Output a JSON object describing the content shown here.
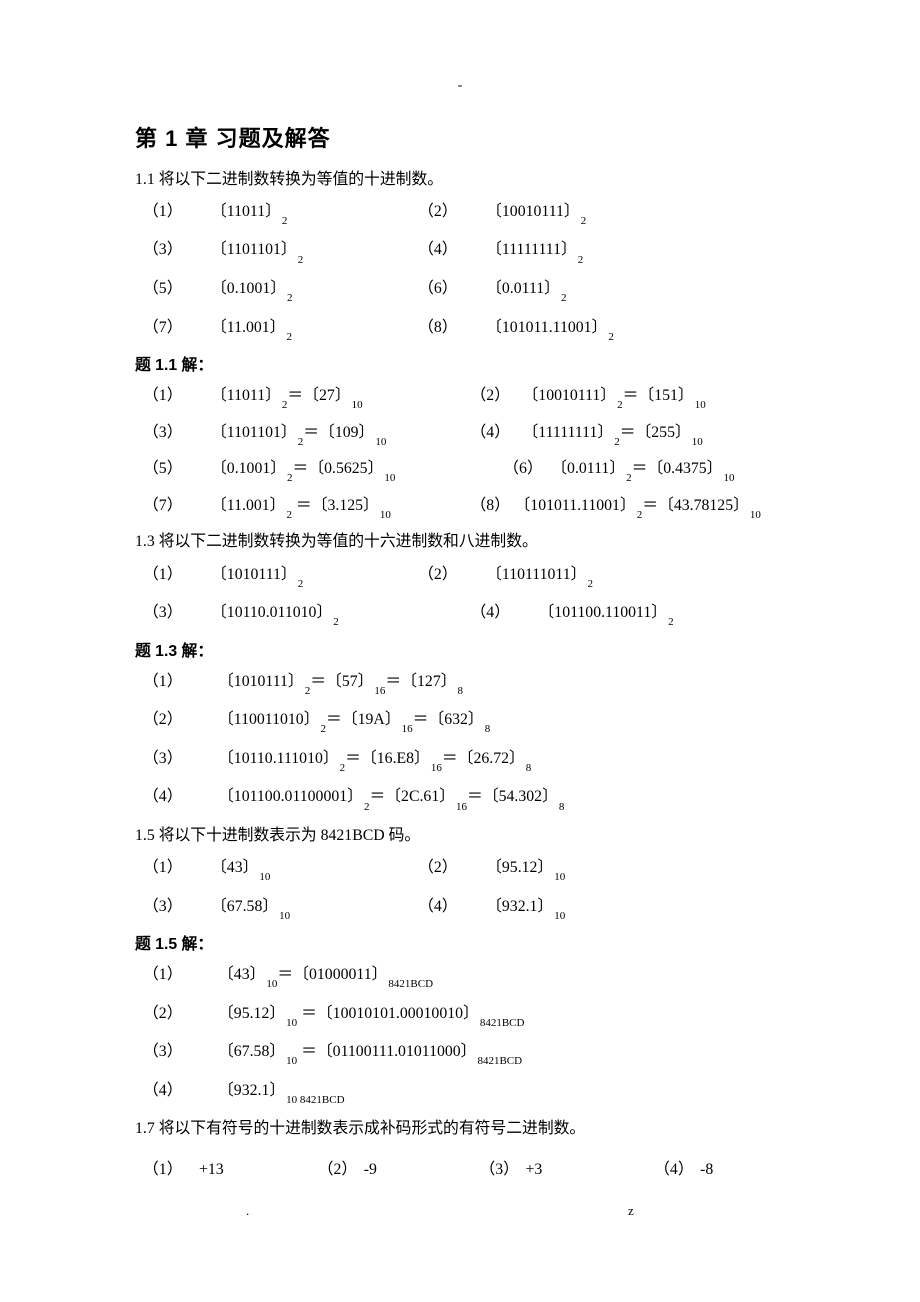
{
  "top_dash": "-",
  "chapter_title": "第 1 章 习题及解答",
  "s11": {
    "title": "1.1 将以下二进制数转换为等值的十进制数。",
    "items": [
      {
        "n": "（1）",
        "v": "〔11011〕",
        "b": "2"
      },
      {
        "n": "（2）",
        "v": "〔10010111〕",
        "b": "2"
      },
      {
        "n": "（3）",
        "v": "〔1101101〕",
        "b": "2"
      },
      {
        "n": "（4）",
        "v": "〔11111111〕",
        "b": "2"
      },
      {
        "n": "（5）",
        "v": "〔0.1001〕",
        "b": "2"
      },
      {
        "n": "（6）",
        "v": "〔0.0111〕",
        "b": "2"
      },
      {
        "n": "（7）",
        "v": "〔11.001〕",
        "b": "2"
      },
      {
        "n": "（8）",
        "v": "〔101011.11001〕",
        "b": "2"
      }
    ],
    "sol_title": "题 1.1  解：",
    "sol": [
      {
        "n": "（1）",
        "l": "〔11011〕",
        "lb": "2",
        "m": "＝〔27〕",
        "rb": "10"
      },
      {
        "n": "（2）",
        "l": "〔10010111〕",
        "lb": "2",
        "m": "＝〔151〕",
        "rb": "10"
      },
      {
        "n": "（3）",
        "l": "〔1101101〕",
        "lb": "2",
        "m": "＝〔109〕",
        "rb": "10"
      },
      {
        "n": "（4）",
        "l": "〔11111111〕",
        "lb": "2",
        "m": "＝〔255〕",
        "rb": "10"
      },
      {
        "n": "（5）",
        "l": "〔0.1001〕",
        "lb": "2",
        "m": "＝〔0.5625〕",
        "rb": "10"
      },
      {
        "n": "（6）",
        "l": "〔0.0111〕",
        "lb": "2",
        "m": "＝〔0.4375〕",
        "rb": "10"
      },
      {
        "n": "（7）",
        "l": "〔11.001〕",
        "lb": "2",
        "m": " ＝〔3.125〕",
        "rb": "10"
      },
      {
        "n": "（8）",
        "l": "〔101011.11001〕",
        "lb": "2",
        "m": "＝〔43.78125〕",
        "rb": "10"
      }
    ]
  },
  "s13": {
    "title": "1.3 将以下二进制数转换为等值的十六进制数和八进制数。",
    "items": [
      {
        "n": "（1）",
        "v": "〔1010111〕",
        "b": "2"
      },
      {
        "n": "（2）",
        "v": "〔110111011〕",
        "b": "2"
      },
      {
        "n": "（3）",
        "v": "〔10110.011010〕",
        "b": "2"
      },
      {
        "n": "（4）",
        "v": "〔101100.110011〕",
        "b": "2"
      }
    ],
    "sol_title": "题 1.3  解：",
    "sol": [
      {
        "n": "（1）",
        "a": "〔1010111〕",
        "ab": "2",
        "b": "＝〔57〕",
        "bb": "16",
        "c": "＝〔127〕",
        "cb": "8"
      },
      {
        "n": "（2）",
        "a": "〔110011010〕",
        "ab": "2",
        "b": "＝〔19A〕",
        "bb": "16",
        "c": "＝〔632〕",
        "cb": "8"
      },
      {
        "n": "（3）",
        "a": "〔10110.111010〕",
        "ab": "2",
        "b": "＝〔16.E8〕",
        "bb": "16",
        "c": "＝〔26.72〕",
        "cb": "8"
      },
      {
        "n": "（4）",
        "a": "〔101100.01100001〕",
        "ab": "2",
        "b": "＝〔2C.61〕",
        "bb": "16",
        "c": "＝〔54.302〕",
        "cb": "8"
      }
    ]
  },
  "s15": {
    "title": "1.5 将以下十进制数表示为 8421BCD 码。",
    "items": [
      {
        "n": "（1）",
        "v": "〔43〕",
        "b": "10"
      },
      {
        "n": "（2）",
        "v": "〔95.12〕",
        "b": "10"
      },
      {
        "n": "（3）",
        "v": "〔67.58〕",
        "b": "10"
      },
      {
        "n": "（4）",
        "v": "〔932.1〕",
        "b": "10"
      }
    ],
    "sol_title": "题 1.5  解：",
    "sol": [
      {
        "n": "（1）",
        "a": "〔43〕",
        "ab": "10",
        "b": "＝〔01000011〕",
        "bb": "8421BCD"
      },
      {
        "n": "（2）",
        "a": "〔95.12〕",
        "ab": "10",
        "b": " ＝〔10010101.00010010〕",
        "bb": "8421BCD"
      },
      {
        "n": "（3）",
        "a": "〔67.58〕",
        "ab": "10",
        "b": " ＝〔01100111.01011000〕",
        "bb": "8421BCD"
      },
      {
        "n": "（4）",
        "a": "〔932.1〕",
        "ab": "10  8421BCD",
        "b": "",
        "bb": ""
      }
    ]
  },
  "s17": {
    "title": "1.7 将以下有符号的十进制数表示成补码形式的有符号二进制数。",
    "items": [
      {
        "n": "（1）",
        "v": "+13"
      },
      {
        "n": "（2）",
        "v": "-9"
      },
      {
        "n": "（3）",
        "v": "+3"
      },
      {
        "n": "（4）",
        "v": "-8"
      }
    ]
  },
  "footer_dot": ".",
  "footer_z": "z"
}
